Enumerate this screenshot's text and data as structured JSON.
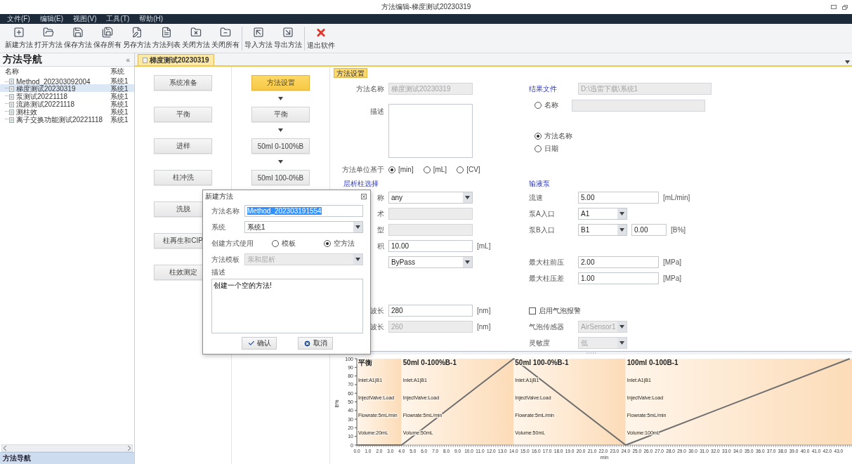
{
  "window": {
    "title": "方法编辑-梯度测试20230319"
  },
  "menu": [
    "文件(F)",
    "编辑(E)",
    "视图(V)",
    "工具(T)",
    "帮助(H)"
  ],
  "toolbar": {
    "groups": [
      [
        "新建方法",
        "打开方法",
        "保存方法",
        "保存所有",
        "另存方法",
        "方法列表",
        "关闭方法",
        "关闭所有"
      ],
      [
        "导入方法",
        "导出方法"
      ],
      [
        "退出软件"
      ]
    ]
  },
  "navigator": {
    "title": "方法导航",
    "collapse": "«",
    "columns": [
      "名称",
      "系统"
    ],
    "items": [
      {
        "name": "Method_202303092004",
        "system": "系统1",
        "selected": false
      },
      {
        "name": "梯度测试20230319",
        "system": "系统1",
        "selected": true
      },
      {
        "name": "泵测试20221118",
        "system": "系统1",
        "selected": false
      },
      {
        "name": "流路测试20221118",
        "system": "系统1",
        "selected": false
      },
      {
        "name": "测柱效",
        "system": "系统1",
        "selected": false
      },
      {
        "name": "离子交换功能测试20221118",
        "system": "系统1",
        "selected": false
      }
    ],
    "footer": "方法导航"
  },
  "tabs": [
    {
      "label": "梯度测试20230319",
      "selected": true
    }
  ],
  "steps": {
    "library": [
      "系统准备",
      "平衡",
      "进样",
      "柱冲洗",
      "洗脱",
      "柱再生和CIP",
      "柱效测定"
    ],
    "sequence": [
      {
        "label": "方法设置",
        "selected": true
      },
      {
        "label": "平衡",
        "selected": false
      },
      {
        "label": "50ml 0-100%B",
        "selected": false
      },
      {
        "label": "50ml 100-0%B",
        "selected": false
      }
    ]
  },
  "settings": {
    "tag": "方法设置",
    "rows": [
      {
        "left": {
          "kind": "input",
          "label": "方法名称",
          "value": "梯度测试20230319",
          "disabled": true
        },
        "right": {
          "kind": "input",
          "label": "结果文件",
          "value": "D:\\迅雷下载\\系统1",
          "disabled": true,
          "link": true
        }
      },
      {
        "left": {
          "kind": "textarea",
          "label": "描述"
        },
        "right": {
          "kind": "radio_group",
          "options": [
            {
              "label": "名称",
              "selected": false,
              "field": {
                "disabled": true
              }
            },
            {
              "label": "方法名称",
              "selected": true
            },
            {
              "label": "日期",
              "selected": false
            }
          ]
        }
      },
      {
        "left": {
          "kind": "radios",
          "label": "方法单位基于",
          "options": [
            {
              "label": "[min]",
              "selected": true
            },
            {
              "label": "[mL]",
              "selected": false
            },
            {
              "label": "[CV]",
              "selected": false
            }
          ]
        }
      },
      {
        "left": {
          "kind": "heading",
          "label": "层析柱选择"
        },
        "right": {
          "kind": "heading",
          "label": "输液泵"
        }
      },
      {
        "left": {
          "kind": "select",
          "label": "称",
          "value": "any"
        },
        "right": {
          "kind": "input",
          "label": "流速",
          "value": "5.00",
          "unit": "[mL/min]"
        }
      },
      {
        "left": {
          "kind": "input",
          "label": "术",
          "disabled": true
        },
        "right": {
          "kind": "select",
          "label": "泵A入口",
          "value": "A1"
        }
      },
      {
        "left": {
          "kind": "input",
          "label": "型",
          "disabled": true
        },
        "right": {
          "kind": "select",
          "label": "泵B入口",
          "value": "B1",
          "extra": {
            "value": "0.00",
            "unit": "[B%]"
          }
        }
      },
      {
        "left": {
          "kind": "input",
          "label": "积",
          "value": "10.00",
          "unit": "[mL]"
        }
      },
      {
        "left": {
          "kind": "select",
          "value": "ByPass"
        },
        "right": {
          "kind": "input",
          "label": "最大柱前压",
          "value": "2.00",
          "unit": "[MPa]"
        }
      },
      {
        "right": {
          "kind": "input",
          "label": "最大柱压差",
          "value": "1.00",
          "unit": "[MPa]"
        }
      },
      {
        "left": {
          "kind": "input",
          "label": "波长",
          "value": "280",
          "unit": "[nm]"
        },
        "right": {
          "kind": "checkbox",
          "label": "启用气泡报警",
          "checked": false
        }
      },
      {
        "left": {
          "kind": "input",
          "label": "波长",
          "value": "260",
          "unit": "[nm]",
          "disabled": true
        },
        "right": {
          "kind": "select",
          "label": "气泡传感器",
          "value": "AirSensor1",
          "disabled": true
        }
      },
      {
        "right": {
          "kind": "select",
          "label": "灵敏度",
          "value": "低",
          "disabled": true
        }
      }
    ]
  },
  "chart_data": {
    "type": "line",
    "xlabel": "min",
    "ylabel": "B%",
    "xlim": [
      0,
      44.2
    ],
    "ylim": [
      0,
      100
    ],
    "x": [
      0,
      4,
      14,
      24,
      44
    ],
    "series": [
      {
        "color": "#6f6f6f",
        "values": [
          0,
          0,
          100,
          0,
          100
        ]
      }
    ],
    "yticks": [
      0,
      10,
      20,
      30,
      40,
      50,
      60,
      70,
      80,
      90,
      100
    ],
    "xticks": [
      {
        "value": 0,
        "label": "0.0"
      },
      {
        "value": 1,
        "label": "1.0"
      },
      {
        "value": 2,
        "label": "2.0"
      },
      {
        "value": 3,
        "label": "3.0"
      },
      {
        "value": 4,
        "label": "4.0"
      },
      {
        "value": 5,
        "label": "5.0"
      },
      {
        "value": 6,
        "label": "6.0"
      },
      {
        "value": 7,
        "label": "7.0"
      },
      {
        "value": 8,
        "label": "8.0"
      },
      {
        "value": 9,
        "label": "9.0"
      },
      {
        "value": 10,
        "label": "10.0"
      },
      {
        "value": 11,
        "label": "11.0"
      },
      {
        "value": 12,
        "label": "12.0"
      },
      {
        "value": 13,
        "label": "13.0"
      },
      {
        "value": 14,
        "label": "14.0"
      },
      {
        "value": 15,
        "label": "15.0"
      },
      {
        "value": 16,
        "label": "16.0"
      },
      {
        "value": 17,
        "label": "17.0"
      },
      {
        "value": 18,
        "label": "18.0"
      },
      {
        "value": 19,
        "label": "19.0"
      },
      {
        "value": 20,
        "label": "20.0"
      },
      {
        "value": 21,
        "label": "21.0"
      },
      {
        "value": 22,
        "label": "22.0"
      },
      {
        "value": 23,
        "label": "23.0"
      },
      {
        "value": 24,
        "label": "24.0"
      },
      {
        "value": 25,
        "label": "25.0"
      },
      {
        "value": 26,
        "label": "26.0"
      },
      {
        "value": 27,
        "label": "27.0"
      },
      {
        "value": 28,
        "label": "28.0"
      },
      {
        "value": 29,
        "label": "29.0"
      },
      {
        "value": 30,
        "label": "30.0"
      },
      {
        "value": 31,
        "label": "31.0"
      },
      {
        "value": 32,
        "label": "32.0"
      },
      {
        "value": 33,
        "label": "33.0"
      },
      {
        "value": 34,
        "label": "34.0"
      },
      {
        "value": 35,
        "label": "35.0"
      },
      {
        "value": 36,
        "label": "36.0"
      },
      {
        "value": 37,
        "label": "37.0"
      },
      {
        "value": 38,
        "label": "38.0"
      },
      {
        "value": 39,
        "label": "39.0"
      },
      {
        "value": 40,
        "label": "40.0"
      },
      {
        "value": 41,
        "label": "41.0"
      },
      {
        "value": 42,
        "label": "42.0"
      },
      {
        "value": 43,
        "label": "43.0"
      }
    ]
  },
  "chart_segments": [
    {
      "title": "平衡",
      "lines": [
        "Inlet:A1|B1",
        "InjectValve:Load",
        "Flowrate:5mL/min",
        "Volume:20mL"
      ]
    },
    {
      "title": "50ml 0-100%B-1",
      "lines": [
        "Inlet:A1|B1",
        "InjectValve:Load",
        "Flowrate:5mL/min",
        "Volume:50mL"
      ]
    },
    {
      "title": "50ml 100-0%B-1",
      "lines": [
        "Inlet:A1|B1",
        "InjectValve:Load",
        "Flowrate:5mL/min",
        "Volume:50mL"
      ]
    },
    {
      "title": "100ml 0-100B-1",
      "lines": [
        "Inlet:A1|B1",
        "InjectValve:Load",
        "Flowrate:5mL/min",
        "Volume:100mL"
      ]
    }
  ],
  "dialog": {
    "title": "新建方法",
    "fields": [
      {
        "kind": "input",
        "label": "方法名称",
        "value": "Method_202303191554",
        "highlighted": true
      },
      {
        "kind": "select",
        "label": "系统",
        "value": "系统1"
      },
      {
        "kind": "radios",
        "label": "创建方式使用",
        "options": [
          {
            "label": "模板",
            "selected": false
          },
          {
            "label": "空方法",
            "selected": true
          }
        ]
      },
      {
        "kind": "select",
        "label": "方法模板",
        "value": "亲和层析",
        "disabled": true
      }
    ],
    "description": {
      "label": "描述",
      "value": "创建一个空的方法!"
    },
    "buttons": [
      {
        "label": "确认",
        "kind": "confirm"
      },
      {
        "label": "取消",
        "kind": "cancel"
      }
    ]
  }
}
